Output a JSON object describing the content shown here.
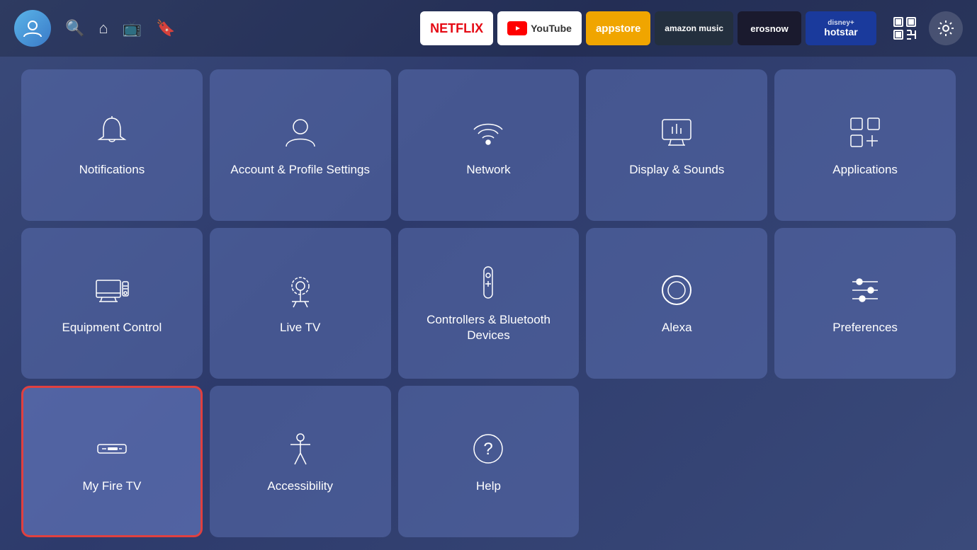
{
  "topbar": {
    "avatar_label": "User Avatar",
    "search_label": "Search",
    "home_label": "Home",
    "tv_label": "Live TV",
    "watchlist_label": "Watchlist",
    "apps": [
      {
        "id": "netflix",
        "label": "NETFLIX",
        "class": "app-netflix"
      },
      {
        "id": "youtube",
        "label": "YouTube",
        "class": "app-youtube"
      },
      {
        "id": "appstore",
        "label": "appstore",
        "class": "app-appstore"
      },
      {
        "id": "amazon-music",
        "label": "amazon music",
        "class": "app-amazon-music"
      },
      {
        "id": "erosnow",
        "label": "erosnow",
        "class": "app-erosnow"
      },
      {
        "id": "hotstar",
        "label": "disney+ hotstar",
        "class": "app-hotstar"
      }
    ],
    "qr_label": "QR Code",
    "settings_label": "Settings"
  },
  "grid": {
    "items": [
      {
        "id": "notifications",
        "label": "Notifications",
        "icon": "bell",
        "selected": false
      },
      {
        "id": "account-profile",
        "label": "Account & Profile Settings",
        "icon": "person",
        "selected": false
      },
      {
        "id": "network",
        "label": "Network",
        "icon": "wifi",
        "selected": false
      },
      {
        "id": "display-sounds",
        "label": "Display & Sounds",
        "icon": "monitor",
        "selected": false
      },
      {
        "id": "applications",
        "label": "Applications",
        "icon": "apps",
        "selected": false
      },
      {
        "id": "equipment-control",
        "label": "Equipment Control",
        "icon": "computer",
        "selected": false
      },
      {
        "id": "live-tv",
        "label": "Live TV",
        "icon": "antenna",
        "selected": false
      },
      {
        "id": "controllers-bluetooth",
        "label": "Controllers & Bluetooth Devices",
        "icon": "remote",
        "selected": false
      },
      {
        "id": "alexa",
        "label": "Alexa",
        "icon": "alexa",
        "selected": false
      },
      {
        "id": "preferences",
        "label": "Preferences",
        "icon": "sliders",
        "selected": false
      },
      {
        "id": "my-fire-tv",
        "label": "My Fire TV",
        "icon": "firetv",
        "selected": true
      },
      {
        "id": "accessibility",
        "label": "Accessibility",
        "icon": "accessibility",
        "selected": false
      },
      {
        "id": "help",
        "label": "Help",
        "icon": "help",
        "selected": false
      }
    ]
  }
}
